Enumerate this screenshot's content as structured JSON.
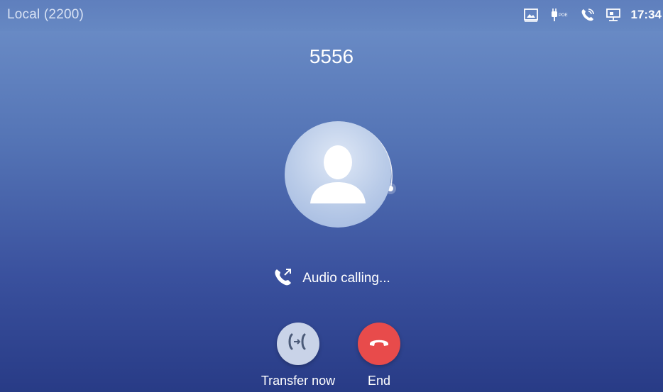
{
  "status_bar": {
    "line_label": "Local (2200)",
    "time": "17:34",
    "icons": [
      "screenshot-icon",
      "poe-icon",
      "call-in-progress-icon",
      "network-icon"
    ],
    "poe_text": "POE"
  },
  "call": {
    "callee": "5556",
    "status_text": "Audio calling...",
    "status_icon": "outgoing-call-icon"
  },
  "actions": {
    "transfer_label": "Transfer now",
    "end_label": "End"
  },
  "colors": {
    "end_button": "#e84b4b",
    "transfer_button": "#c9d3e8"
  }
}
